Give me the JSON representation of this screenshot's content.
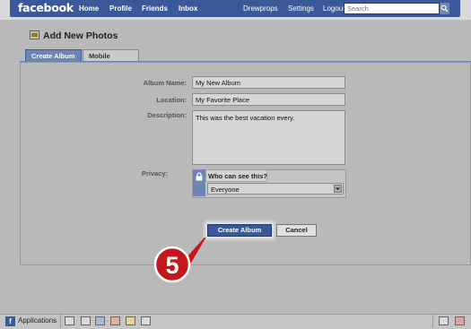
{
  "topnav": {
    "logo": "facebook",
    "links": [
      "Home",
      "Profile",
      "Friends",
      "Inbox"
    ],
    "right_links": [
      "Drewprops",
      "Settings",
      "Logout"
    ],
    "search_placeholder": "Search"
  },
  "page": {
    "title": "Add New Photos",
    "tabs": [
      "Create Album",
      "Mobile Photos"
    ]
  },
  "form": {
    "album_name_label": "Album Name:",
    "album_name_value": "My New Album",
    "location_label": "Location:",
    "location_value": "My Favorite Place",
    "description_label": "Description:",
    "description_value": "This was the best vacation every.",
    "privacy_label": "Privacy:",
    "privacy_prompt": "Who can see this?",
    "privacy_value": "Everyone"
  },
  "buttons": {
    "create_album": "Create Album",
    "cancel": "Cancel"
  },
  "callout": {
    "step": "5"
  },
  "bottombar": {
    "applications_label": "Applications"
  },
  "colors": {
    "brand": "#3b5998",
    "brand_light": "#6d84b4",
    "callout_red": "#c4171c"
  }
}
